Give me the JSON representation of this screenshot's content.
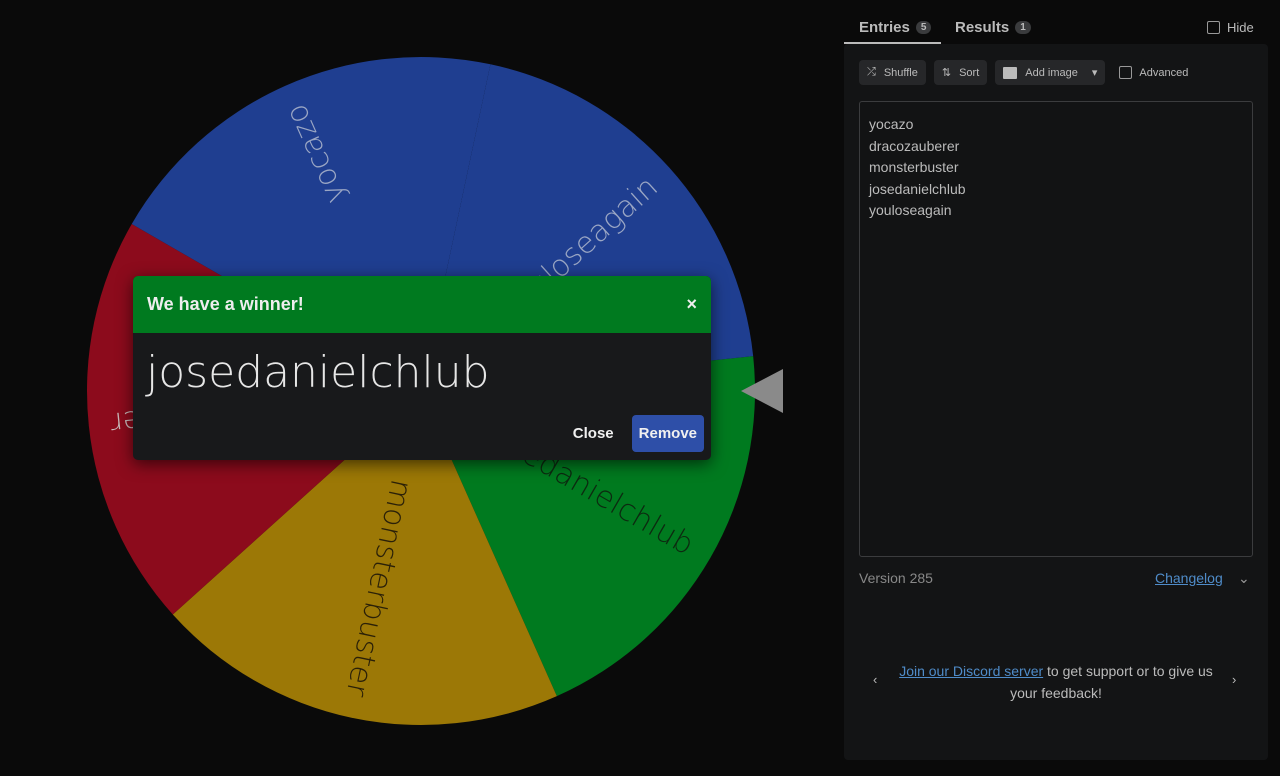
{
  "wheel": {
    "segments": [
      {
        "label": "josedanielchlub",
        "color": "#007a1f",
        "text_color": "#0c2a10"
      },
      {
        "label": "monsterbuster",
        "color": "#9c7806",
        "text_color": "#2a2008"
      },
      {
        "label": "dracozauberer",
        "color": "#8c0b1c",
        "text_color": "#c8b8b8"
      },
      {
        "label": "yocazo",
        "color": "#1f3e90",
        "text_color": "#9aa6c4"
      },
      {
        "label": "youloseagain",
        "color": "#1f3e90",
        "text_color": "#9aa6c4"
      }
    ]
  },
  "dialog": {
    "title": "We have a winner!",
    "winner": "josedanielchlub",
    "close_label": "Close",
    "remove_label": "Remove",
    "close_icon": "×",
    "header_color": "#007a1f"
  },
  "tabs": [
    {
      "label": "Entries",
      "count": "5"
    },
    {
      "label": "Results",
      "count": "1"
    }
  ],
  "hide_label": "Hide",
  "toolbar": {
    "shuffle": "Shuffle",
    "sort": "Sort",
    "add_image": "Add image",
    "advanced": "Advanced"
  },
  "entries": [
    "yocazo",
    "dracozauberer",
    "monsterbuster",
    "josedanielchlub",
    "youloseagain"
  ],
  "footer": {
    "version": "Version 285",
    "changelog": "Changelog",
    "discord_link": "Join our Discord server",
    "discord_text": " to get support or to give us your feedback!"
  }
}
